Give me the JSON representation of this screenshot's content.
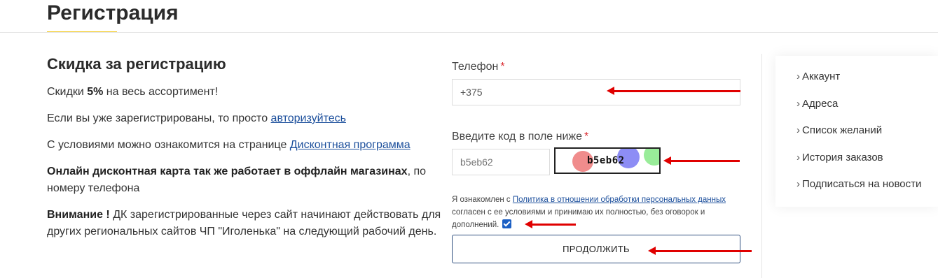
{
  "header": {
    "title": "Регистрация"
  },
  "promo": {
    "heading": "Скидка за регистрацию",
    "discount_pre": "Скидки ",
    "discount_value": "5%",
    "discount_post": " на весь ассортимент!",
    "registered_text": "Если вы уже зарегистрированы, то просто ",
    "login_link": "авторизуйтесь",
    "conditions_text": "С условиями можно ознакомится на странице ",
    "discount_program_link": "Дисконтная программа",
    "card_bold": "Онлайн дисконтная карта так же работает в оффлайн магазинах",
    "card_rest": ", по номеру телефона",
    "attention_bold": "Внимание !",
    "attention_rest": " ДК зарегистрированные через сайт начинают действовать для других региональных сайтов ЧП \"Иголенька\" на следующий рабочий день."
  },
  "form": {
    "phone_label": "Телефон",
    "phone_value": "+375",
    "required_mark": "*",
    "captcha_label": "Введите код в поле ниже",
    "captcha_placeholder": "b5eb62",
    "captcha_code": "b5eb62",
    "consent_pre": "Я ознакомлен с ",
    "consent_link": "Политика в отношении обработки персональных данных",
    "consent_post": " согласен с ее условиями и принимаю их полностью, без оговорок и дополнений.",
    "consent_checked": true,
    "submit_label": "ПРОДОЛЖИТЬ"
  },
  "sidebar": {
    "chevron": "›",
    "items": [
      {
        "label": "Аккаунт"
      },
      {
        "label": "Адреса"
      },
      {
        "label": "Список желаний"
      },
      {
        "label": "История заказов"
      },
      {
        "label": "Подписаться на новости"
      }
    ]
  },
  "colors": {
    "accent_underline": "#f2c200",
    "link": "#1c4f9c",
    "required": "#d9262c",
    "checkbox": "#1b5fc4",
    "annotation_arrow": "#e00000"
  }
}
